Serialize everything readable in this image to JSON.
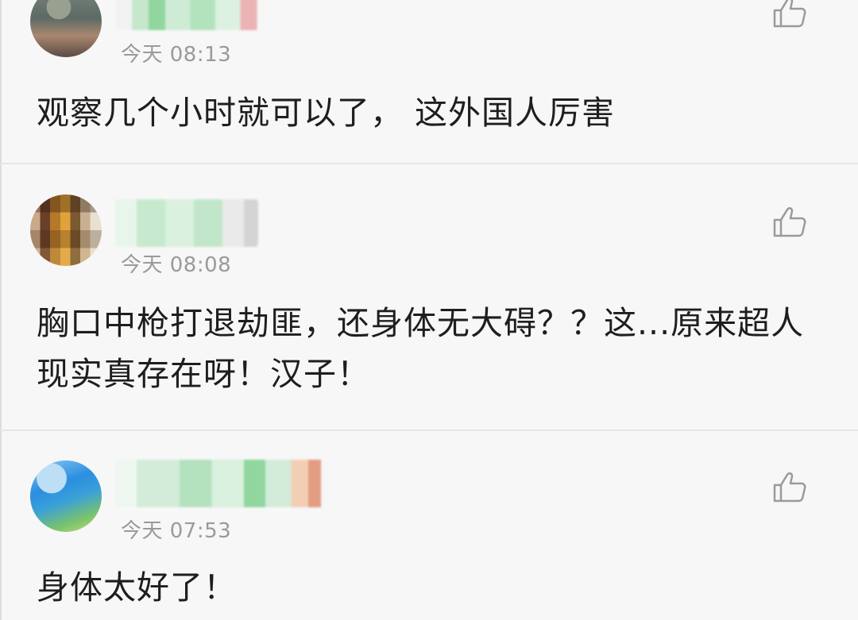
{
  "comments": [
    {
      "time": "今天 08:13",
      "text": "观察几个小时就可以了， 这外国人厉害",
      "avatar": "user-avatar-photo",
      "username_blurred": true
    },
    {
      "time": "今天 08:08",
      "text": "胸口中枪打退劫匪，还身体无大碍？？这...原来超人现实真存在呀！汉子！",
      "avatar": "user-avatar-photo",
      "username_blurred": true
    },
    {
      "time": "今天 07:53",
      "text": "身体太好了！",
      "avatar": "user-avatar-photo",
      "username_blurred": true
    }
  ],
  "icons": {
    "like": "thumbs-up-icon"
  },
  "colors": {
    "background": "#f7f7f7",
    "text": "#1e1e1e",
    "timestamp": "#9a9a9a",
    "divider": "#e6e6e6",
    "icon": "#9a9a9a"
  }
}
